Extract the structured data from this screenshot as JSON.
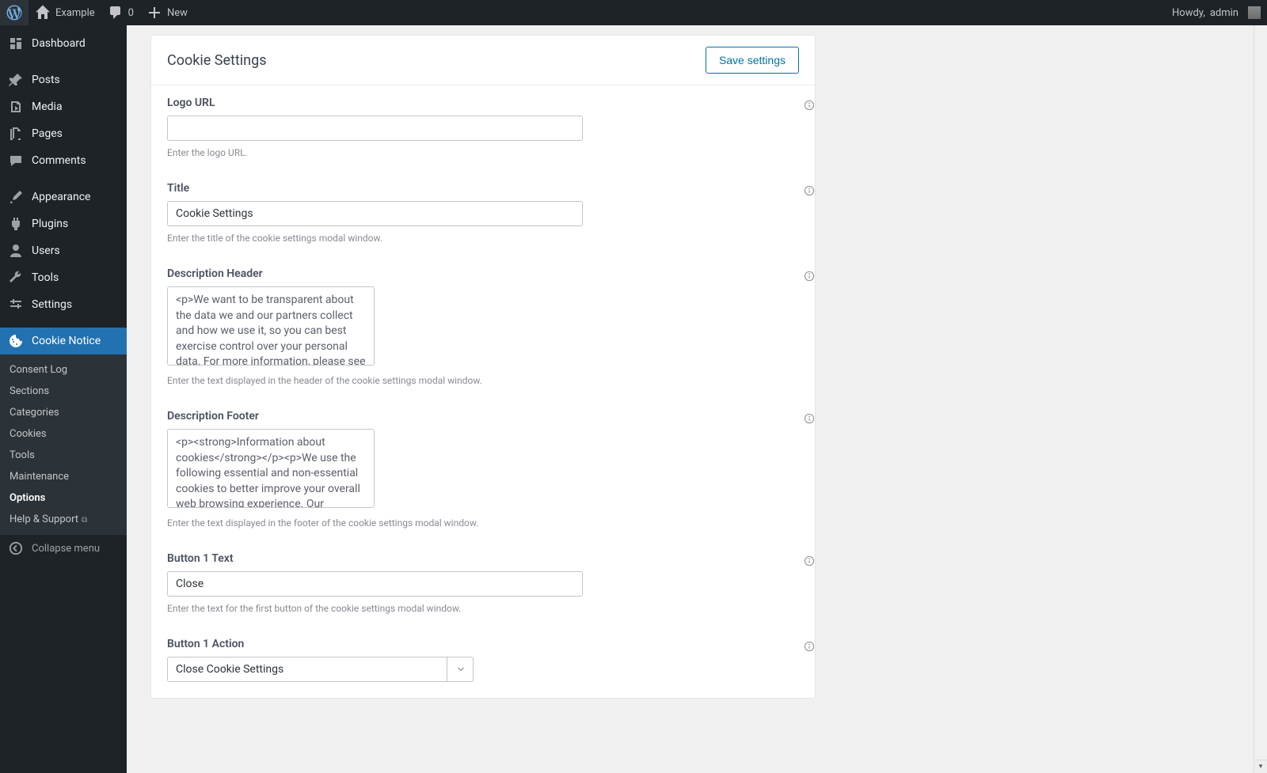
{
  "adminbar": {
    "site_name": "Example",
    "comments_count": "0",
    "new_label": "New",
    "howdy_prefix": "Howdy, ",
    "username": "admin"
  },
  "sidebar": {
    "items": [
      {
        "label": "Dashboard"
      },
      {
        "label": "Posts"
      },
      {
        "label": "Media"
      },
      {
        "label": "Pages"
      },
      {
        "label": "Comments"
      },
      {
        "label": "Appearance"
      },
      {
        "label": "Plugins"
      },
      {
        "label": "Users"
      },
      {
        "label": "Tools"
      },
      {
        "label": "Settings"
      },
      {
        "label": "Cookie Notice"
      }
    ],
    "submenu": [
      {
        "label": "Consent Log"
      },
      {
        "label": "Sections"
      },
      {
        "label": "Categories"
      },
      {
        "label": "Cookies"
      },
      {
        "label": "Tools"
      },
      {
        "label": "Maintenance"
      },
      {
        "label": "Options"
      },
      {
        "label": "Help & Support"
      }
    ],
    "collapse_label": "Collapse menu"
  },
  "page": {
    "panel_title": "Cookie Settings",
    "save_button": "Save settings",
    "fields": {
      "logo_url": {
        "label": "Logo URL",
        "value": "",
        "help": "Enter the logo URL."
      },
      "title": {
        "label": "Title",
        "value": "Cookie Settings",
        "help": "Enter the title of the cookie settings modal window."
      },
      "desc_header": {
        "label": "Description Header",
        "value": "<p>We want to be transparent about the data we and our partners collect and how we use it, so you can best exercise control over your personal data. For more information, please see our Privacy Policy.</p><p><strong>Information we collect</strong></p><p>We use this",
        "help": "Enter the text displayed in the header of the cookie settings modal window."
      },
      "desc_footer": {
        "label": "Description Footer",
        "value": "<p><strong>Information about cookies</strong></p><p>We use the following essential and non-essential cookies to better improve your overall web browsing experience. Our partners use cookies and other mechanisms to connect you with your social networks and tailor",
        "help": "Enter the text displayed in the footer of the cookie settings modal window."
      },
      "button1_text": {
        "label": "Button 1 Text",
        "value": "Close",
        "help": "Enter the text for the first button of the cookie settings modal window."
      },
      "button1_action": {
        "label": "Button 1 Action",
        "value": "Close Cookie Settings"
      }
    }
  }
}
